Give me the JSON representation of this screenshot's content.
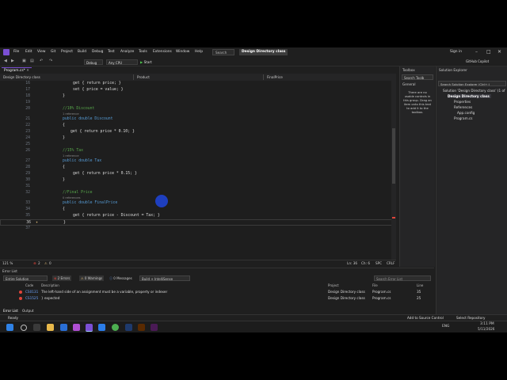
{
  "menubar": {
    "items": [
      "File",
      "Edit",
      "View",
      "Git",
      "Project",
      "Build",
      "Debug",
      "Test",
      "Analyze",
      "Tools",
      "Extensions",
      "Window",
      "Help"
    ],
    "search_label": "Search",
    "solution_title": "Design Directory class",
    "sign_in": "Sign in",
    "github_copilot": "GitHub Copilot"
  },
  "toolbar": {
    "config": "Debug",
    "platform": "Any CPU",
    "start": "Start"
  },
  "tabs": {
    "active_file": "Program.cs*",
    "nav_project": "Design Directory class",
    "nav_class": "Product",
    "nav_member": "FinalPrice"
  },
  "code": {
    "lines": [
      {
        "n": "16",
        "text": "get { return price; }"
      },
      {
        "n": "17",
        "text": "set { price = value; }"
      },
      {
        "n": "18",
        "text": "}"
      },
      {
        "n": "19",
        "text": ""
      },
      {
        "n": "20",
        "text": "//10% Discount"
      },
      {
        "n": "21",
        "text": "public double Discount"
      },
      {
        "n": "22",
        "text": "{"
      },
      {
        "n": "23",
        "text": "get { return price * 0.10; }"
      },
      {
        "n": "24",
        "text": "}"
      },
      {
        "n": "25",
        "text": ""
      },
      {
        "n": "26",
        "text": "//15% Tax"
      },
      {
        "n": "27",
        "text": "public double Tax"
      },
      {
        "n": "28",
        "text": "{"
      },
      {
        "n": "29",
        "text": "get { return price * 0.15; }"
      },
      {
        "n": "30",
        "text": "}"
      },
      {
        "n": "31",
        "text": ""
      },
      {
        "n": "32",
        "text": "//Final Price"
      },
      {
        "n": "33",
        "text": "public double FinalPrice"
      },
      {
        "n": "34",
        "text": "{"
      },
      {
        "n": "35",
        "text": "get { return price - Discount = Tax; }"
      },
      {
        "n": "36",
        "text": "}"
      },
      {
        "n": "37",
        "text": ""
      }
    ],
    "ref1": "1 reference",
    "ref2": "1 reference",
    "ref3": "0 references"
  },
  "editor_status": {
    "zoom": "121 %",
    "errors": "2",
    "warnings": "0",
    "position": "Ln: 36",
    "column": "Ch: 6",
    "spc": "SPC",
    "crlf": "CRLF"
  },
  "error_list": {
    "title": "Error List",
    "scope": "Entire Solution",
    "errors_btn": "2 Errors",
    "warnings_btn": "0 Warnings",
    "messages_btn": "0 Messages",
    "build_filter": "Build + IntelliSense",
    "search_placeholder": "Search Error List",
    "headers": {
      "code": "Code",
      "description": "Description",
      "project": "Project",
      "file": "File",
      "line": "Line"
    },
    "rows": [
      {
        "code": "CS0131",
        "description": "The left-hand side of an assignment must be a variable, property or indexer",
        "project": "Design Directory class",
        "file": "Program.cs",
        "line": "35"
      },
      {
        "code": "CS1525",
        "description": "} expected",
        "project": "Design Directory class",
        "file": "Program.cs",
        "line": "25"
      }
    ],
    "tab_error": "Error List",
    "tab_output": "Output"
  },
  "status": {
    "ready": "Ready",
    "add_source": "Add to Source Control",
    "select_repo": "Select Repository"
  },
  "toolbox": {
    "title": "Toolbox",
    "search": "Search Toolb",
    "group": "General",
    "empty_text": "There are no usable controls in this group. Drag an item onto this text to add it to the toolbox."
  },
  "solution_explorer": {
    "title": "Solution Explorer",
    "search": "Search Solution Explorer (Ctrl+;)",
    "solution": "Solution 'Design Directory class' (1 of",
    "project": "Design Directory class",
    "items": [
      "Properties",
      "References",
      "App.config",
      "Program.cs"
    ],
    "bottom_tabs": [
      "Properties",
      "Solution Explo...",
      "Class View"
    ]
  },
  "taskbar": {
    "lang": "ENG",
    "time": "3:11 PM",
    "date": "5/11/2026"
  },
  "colors": {
    "vs_purple": "#7b4fd4",
    "error_red": "#e0443a",
    "keyword": "#569cd6",
    "comment": "#57a64a"
  }
}
